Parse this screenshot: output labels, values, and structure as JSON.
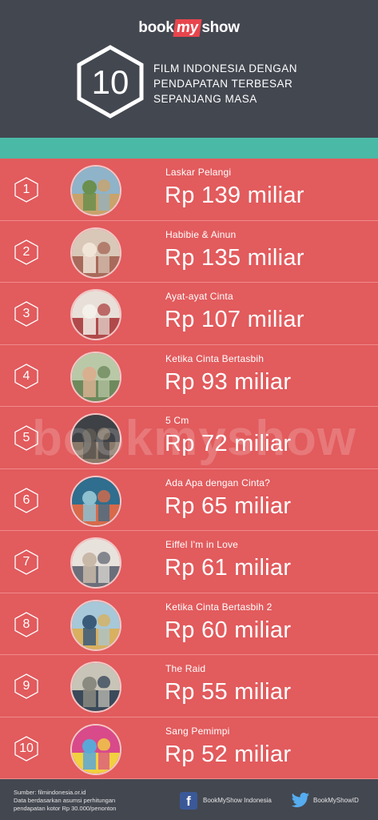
{
  "header": {
    "brand_pre": "book",
    "brand_my": "my",
    "brand_post": "show",
    "big_number": "10",
    "title": "FILM INDONESIA DENGAN PENDAPATAN TERBESAR SEPANJANG MASA"
  },
  "colors": {
    "background": "#434750",
    "accent_teal": "#4ab9a6",
    "row_red": "#e25b5d",
    "brand_red": "#e8454d"
  },
  "films": [
    {
      "rank": "1",
      "title": "Laskar Pelangi",
      "earnings": "Rp 139 miliar"
    },
    {
      "rank": "2",
      "title": "Habibie & Ainun",
      "earnings": "Rp 135 miliar"
    },
    {
      "rank": "3",
      "title": "Ayat-ayat Cinta",
      "earnings": "Rp 107 miliar"
    },
    {
      "rank": "4",
      "title": "Ketika Cinta Bertasbih",
      "earnings": "Rp 93 miliar"
    },
    {
      "rank": "5",
      "title": "5 Cm",
      "earnings": "Rp 72 miliar"
    },
    {
      "rank": "6",
      "title": "Ada Apa dengan Cinta?",
      "earnings": "Rp 65 miliar"
    },
    {
      "rank": "7",
      "title": "Eiffel I'm in Love",
      "earnings": "Rp 61 miliar"
    },
    {
      "rank": "8",
      "title": "Ketika Cinta Bertasbih 2",
      "earnings": "Rp 60 miliar"
    },
    {
      "rank": "9",
      "title": "The Raid",
      "earnings": "Rp 55 miliar"
    },
    {
      "rank": "10",
      "title": "Sang Pemimpi",
      "earnings": "Rp 52 miliar"
    }
  ],
  "footer": {
    "source_line1": "Sumber: filmindonesia.or.id",
    "source_line2": "Data berdasarkan asumsi perhitungan",
    "source_line3": "pendapatan kotor Rp 30.000/penonton",
    "facebook_label": "BookMyShow Indonesia",
    "twitter_label": "BookMyShowID"
  },
  "watermark": "bookmyshow"
}
